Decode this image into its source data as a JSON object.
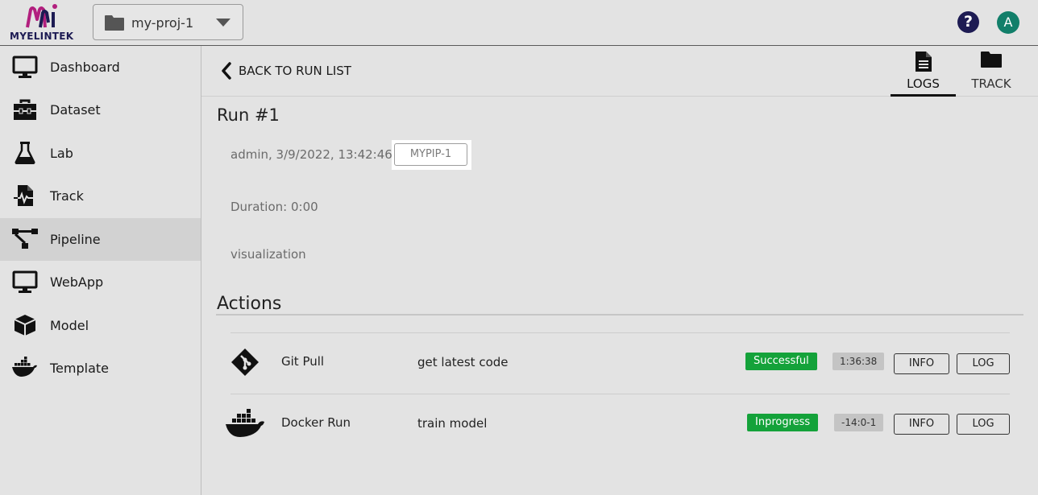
{
  "brand": {
    "name": "MYELINTEK",
    "color": "#1d1b53"
  },
  "header": {
    "project": "my-proj-1",
    "help_icon": "question-circle-icon",
    "avatar_initial": "A",
    "avatar_color": "#127f6a"
  },
  "sidebar": {
    "items": [
      {
        "label": "Dashboard",
        "icon": "monitor-icon"
      },
      {
        "label": "Dataset",
        "icon": "toolbox-icon"
      },
      {
        "label": "Lab",
        "icon": "flask-icon"
      },
      {
        "label": "Track",
        "icon": "track-file-icon"
      },
      {
        "label": "Pipeline",
        "icon": "pipeline-icon",
        "active": true
      },
      {
        "label": "WebApp",
        "icon": "monitor-icon"
      },
      {
        "label": "Model",
        "icon": "cube-icon"
      },
      {
        "label": "Template",
        "icon": "docker-icon"
      }
    ]
  },
  "subheader": {
    "back_label": "BACK TO RUN LIST",
    "tabs": [
      {
        "label": "LOGS",
        "icon": "document-icon",
        "active": true
      },
      {
        "label": "TRACK",
        "icon": "folder-icon",
        "active": false
      }
    ]
  },
  "run": {
    "title": "Run #1",
    "meta": "admin, 3/9/2022, 13:42:46",
    "pipeline_tag": "MYPIP-1",
    "duration": "Duration: 0:00",
    "visualization": "visualization"
  },
  "actions": {
    "title": "Actions",
    "rows": [
      {
        "icon": "git-icon",
        "name": "Git Pull",
        "description": "get latest code",
        "status": "Successful",
        "time": "1:36:38",
        "info_label": "INFO",
        "log_label": "LOG"
      },
      {
        "icon": "docker-icon",
        "name": "Docker Run",
        "description": "train model",
        "status": "Inprogress",
        "time": "-14:0-1",
        "info_label": "INFO",
        "log_label": "LOG"
      }
    ]
  },
  "colors": {
    "status_green": "#14a23a",
    "sidebar_active": "#d2d2d2",
    "background": "#e3e3e3"
  }
}
